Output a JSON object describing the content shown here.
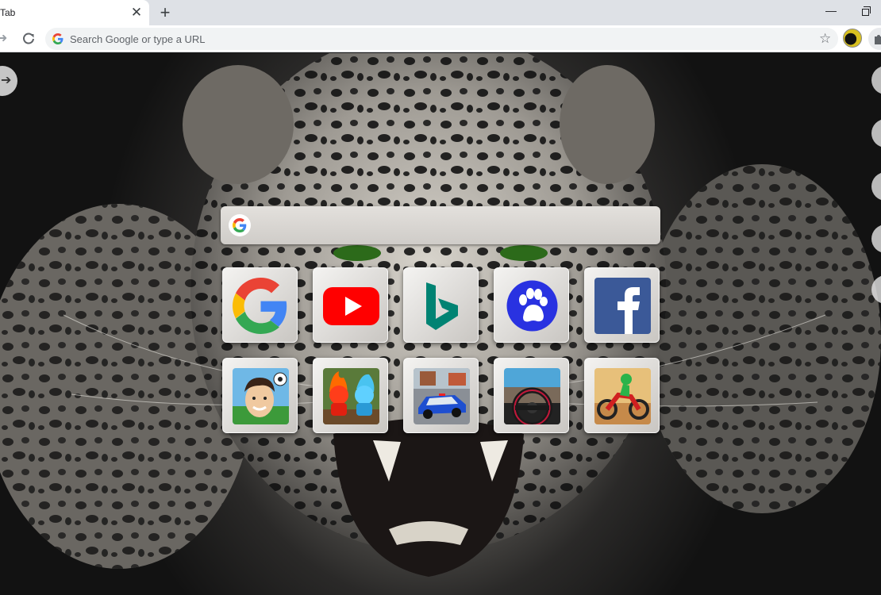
{
  "browser": {
    "tab_title": "Tab",
    "tab_close": "✕",
    "new_tab": "+",
    "minimize": "—",
    "omnibox_placeholder": "Search Google or type a URL"
  },
  "page": {
    "search_placeholder": "",
    "shortcuts": [
      {
        "name": "Google",
        "icon": "google-icon"
      },
      {
        "name": "YouTube",
        "icon": "youtube-icon"
      },
      {
        "name": "Bing",
        "icon": "bing-icon"
      },
      {
        "name": "Baidu",
        "icon": "baidu-paw-icon"
      },
      {
        "name": "Facebook",
        "icon": "facebook-icon"
      },
      {
        "name": "Soccer game",
        "icon": "soccer-player-game-icon"
      },
      {
        "name": "Fire and water game",
        "icon": "fire-water-game-icon"
      },
      {
        "name": "Police car game",
        "icon": "police-car-game-icon"
      },
      {
        "name": "Driving game",
        "icon": "steering-wheel-game-icon"
      },
      {
        "name": "Motocross game",
        "icon": "motocross-game-icon"
      }
    ]
  },
  "colors": {
    "google_blue": "#4285f4",
    "google_red": "#ea4335",
    "google_yellow": "#fbbc05",
    "google_green": "#34a853",
    "youtube_red": "#ff0000",
    "bing_teal": "#008373",
    "baidu_blue": "#2932e1",
    "facebook_blue": "#3b5998"
  }
}
